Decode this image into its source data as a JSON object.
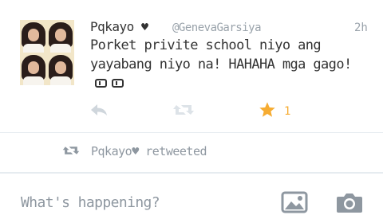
{
  "tweet": {
    "author_name": "Pqkayo",
    "author_heart": "♥",
    "handle": "@GenevaGarsiya",
    "time": "2h",
    "text": "Porket privite school niyo ang yayabang niyo na! HAHAHA mga gago!",
    "favorite_count": "1",
    "favorite_color": "#f6ac32"
  },
  "retweet_context": {
    "user": "Pqkayo",
    "heart": "♥",
    "label": "retweeted"
  },
  "compose": {
    "placeholder": "What's happening?"
  },
  "icons": {
    "reply": "reply-icon",
    "retweet": "retweet-icon",
    "favorite": "star-icon",
    "image": "image-icon",
    "camera": "camera-icon"
  }
}
